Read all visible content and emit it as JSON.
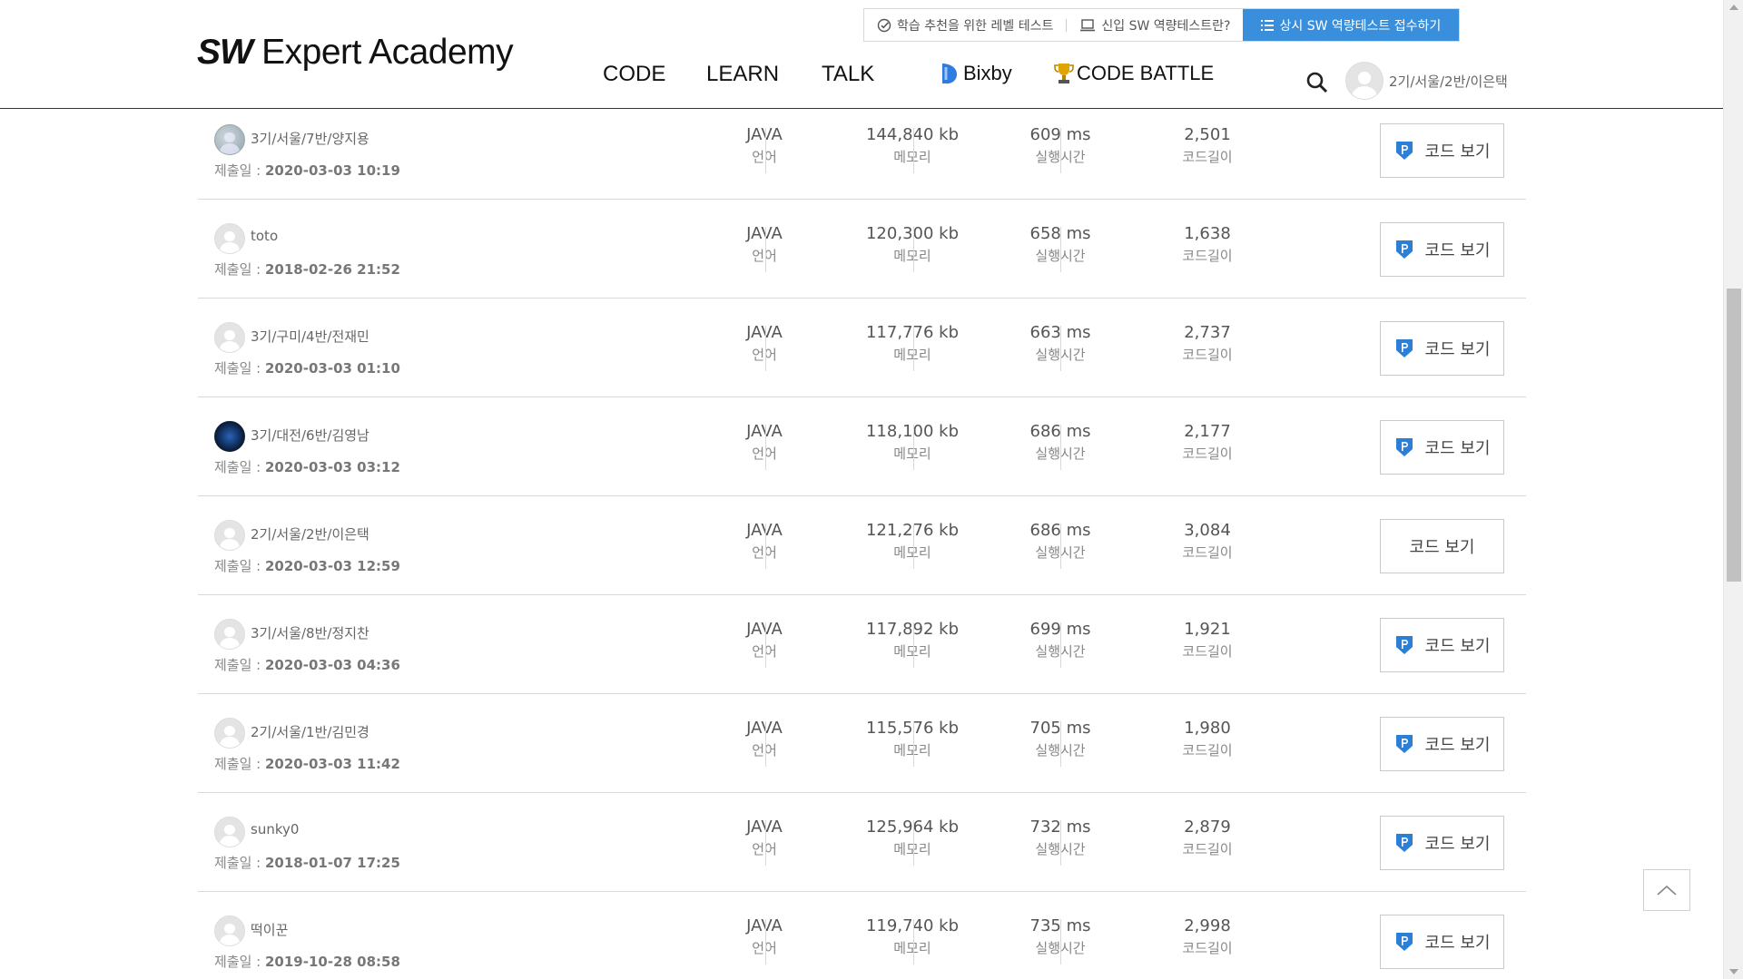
{
  "logo": {
    "bold": "SW",
    "rest": " Expert Academy"
  },
  "topbar": {
    "level_test": "학습 추천을 위한 레벨 테스트",
    "new_test": "신입 SW 역량테스트란?",
    "apply": "상시 SW 역량테스트 접수하기"
  },
  "nav": {
    "code": "CODE",
    "learn": "LEARN",
    "talk": "TALK",
    "bixby": "Bixby",
    "battle": "CODE BATTLE"
  },
  "user": {
    "name": "2기/서울/2반/이은택"
  },
  "labels": {
    "lang": "언어",
    "mem": "메모리",
    "time": "실행시간",
    "len": "코드길이",
    "date_prefix": "제출일 : ",
    "code_btn": "코드 보기"
  },
  "rows": [
    {
      "user": "3기/서울/7반/양지용",
      "date": "2020-03-03 10:19",
      "lang": "JAVA",
      "mem": "144,840 kb",
      "time": "609 ms",
      "len": "2,501",
      "point": true,
      "avatar": "pic1"
    },
    {
      "user": "toto",
      "date": "2018-02-26 21:52",
      "lang": "JAVA",
      "mem": "120,300 kb",
      "time": "658 ms",
      "len": "1,638",
      "point": true,
      "avatar": ""
    },
    {
      "user": "3기/구미/4반/전재민",
      "date": "2020-03-03 01:10",
      "lang": "JAVA",
      "mem": "117,776 kb",
      "time": "663 ms",
      "len": "2,737",
      "point": true,
      "avatar": ""
    },
    {
      "user": "3기/대전/6반/김영남",
      "date": "2020-03-03 03:12",
      "lang": "JAVA",
      "mem": "118,100 kb",
      "time": "686 ms",
      "len": "2,177",
      "point": true,
      "avatar": "pic2"
    },
    {
      "user": "2기/서울/2반/이은택",
      "date": "2020-03-03 12:59",
      "lang": "JAVA",
      "mem": "121,276 kb",
      "time": "686 ms",
      "len": "3,084",
      "point": false,
      "avatar": ""
    },
    {
      "user": "3기/서울/8반/정지찬",
      "date": "2020-03-03 04:36",
      "lang": "JAVA",
      "mem": "117,892 kb",
      "time": "699 ms",
      "len": "1,921",
      "point": true,
      "avatar": ""
    },
    {
      "user": "2기/서울/1반/김민경",
      "date": "2020-03-03 11:42",
      "lang": "JAVA",
      "mem": "115,576 kb",
      "time": "705 ms",
      "len": "1,980",
      "point": true,
      "avatar": ""
    },
    {
      "user": "sunky0",
      "date": "2018-01-07 17:25",
      "lang": "JAVA",
      "mem": "125,964 kb",
      "time": "732 ms",
      "len": "2,879",
      "point": true,
      "avatar": ""
    },
    {
      "user": "떡이꾼",
      "date": "2019-10-28 08:58",
      "lang": "JAVA",
      "mem": "119,740 kb",
      "time": "735 ms",
      "len": "2,998",
      "point": true,
      "avatar": ""
    }
  ],
  "colors": {
    "primary": "#3a8fdc",
    "point_icon": "#2b7fd6"
  }
}
